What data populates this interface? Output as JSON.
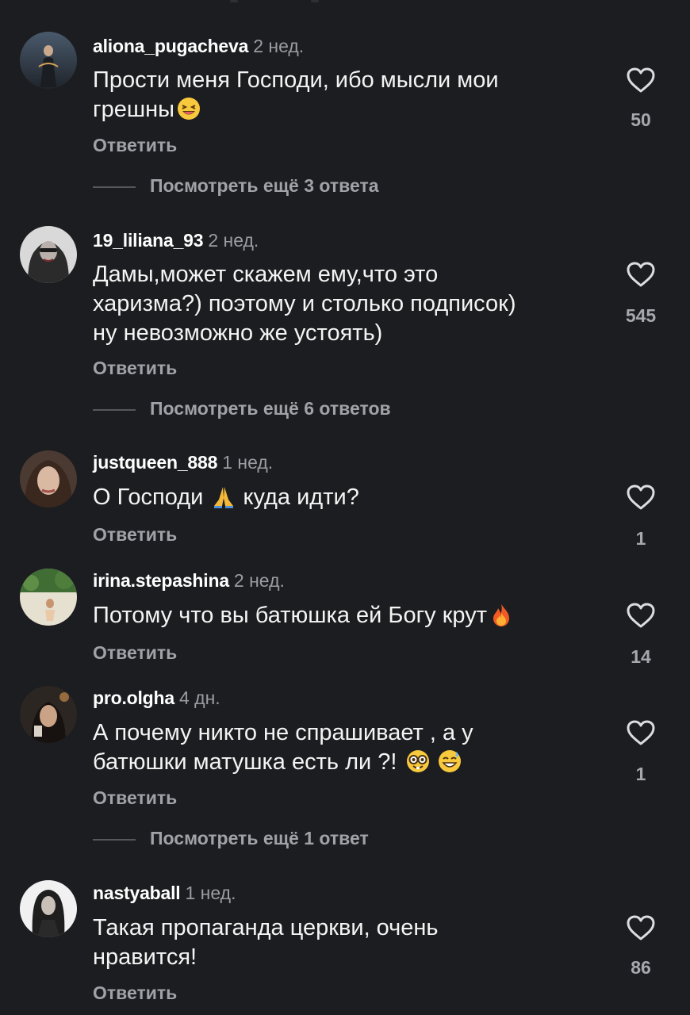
{
  "comments": [
    {
      "username": "aliona_pugacheva",
      "time": "2 нед.",
      "text_before": "Прости меня Господи, ибо мысли мои\nгрешны",
      "emoji": "laughing-face-emoji",
      "text_after": "",
      "reply_label": "Ответить",
      "likes": "50",
      "more_replies": "Посмотреть ещё 3 ответа",
      "avatar_colors": [
        "#3a4656",
        "#2a2f38"
      ]
    },
    {
      "username": "19_liliana_93",
      "time": "2 нед.",
      "text_before": "Дамы,может скажем ему,что это\nхаризма?) поэтому и столько подписок)\nну невозможно же устоять)",
      "emoji": "",
      "text_after": "",
      "reply_label": "Ответить",
      "likes": "545",
      "more_replies": "Посмотреть ещё 6 ответов",
      "avatar_colors": [
        "#d8d8d8",
        "#3a3a3a"
      ]
    },
    {
      "username": "justqueen_888",
      "time": "1 нед.",
      "text_before": "О Господи ",
      "emoji": "folded-hands-emoji",
      "text_after": " куда идти?",
      "reply_label": "Ответить",
      "likes": "1",
      "more_replies": "",
      "avatar_colors": [
        "#8a7566",
        "#3b2a22"
      ]
    },
    {
      "username": "irina.stepashina",
      "time": "2 нед.",
      "text_before": "Потому что вы батюшка ей Богу крут",
      "emoji": "fire-emoji",
      "text_after": "",
      "reply_label": "Ответить",
      "likes": "14",
      "more_replies": "",
      "avatar_colors": [
        "#4f7a3c",
        "#e8e2d2"
      ]
    },
    {
      "username": "pro.olgha",
      "time": "4 дн.",
      "text_before": "А почему никто не спрашивает , а у\nбатюшки матушка есть ли ?! ",
      "emoji": "nerd-face-emoji",
      "emoji2": "grinning-sweat-emoji",
      "text_after": "",
      "reply_label": "Ответить",
      "likes": "1",
      "more_replies": "Посмотреть ещё 1 ответ",
      "avatar_colors": [
        "#2a2420",
        "#8c6e5a"
      ]
    },
    {
      "username": "nastyaball",
      "time": "1 нед.",
      "text_before": "Такая пропаганда церкви, очень\nнравится!",
      "emoji": "",
      "text_after": "",
      "reply_label": "Ответить",
      "likes": "86",
      "more_replies": "",
      "avatar_colors": [
        "#efefef",
        "#1c1c1c"
      ]
    }
  ],
  "colors": {
    "background": "#1c1d20",
    "username": "#ffffff",
    "secondary": "#a0a2a7",
    "heart": "#dcdde0"
  },
  "icons": {
    "like": "heart-outline-icon"
  }
}
